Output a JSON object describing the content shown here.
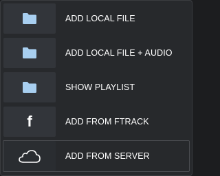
{
  "menu": {
    "items": [
      {
        "label": "ADD LOCAL FILE",
        "icon": "folder-icon"
      },
      {
        "label": "ADD LOCAL FILE + AUDIO",
        "icon": "folder-icon"
      },
      {
        "label": "SHOW PLAYLIST",
        "icon": "folder-icon"
      },
      {
        "label": "ADD FROM FTRACK",
        "icon": "ftrack-logo-icon",
        "glyph": "f"
      },
      {
        "label": "ADD FROM SERVER",
        "icon": "cloud-icon"
      }
    ]
  },
  "colors": {
    "folder": "#a8cff0",
    "text": "#ffffff",
    "icon_bg": "#32353a",
    "menu_bg": "#27292c"
  }
}
